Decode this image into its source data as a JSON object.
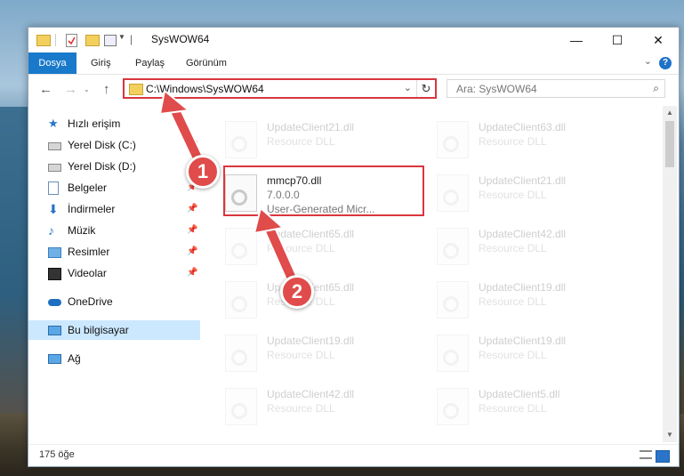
{
  "window": {
    "title": "SysWOW64",
    "controls": {
      "minimize": "—",
      "maximize": "☐",
      "close": "✕"
    }
  },
  "ribbon": {
    "tabs": [
      "Dosya",
      "Giriş",
      "Paylaş",
      "Görünüm"
    ],
    "help": "?"
  },
  "address": {
    "path": "C:\\Windows\\SysWOW64",
    "search_placeholder": "Ara: SysWOW64"
  },
  "nav": {
    "items": [
      {
        "label": "Hızlı erişim",
        "icon": "star-icon"
      },
      {
        "label": "Yerel Disk (C:)",
        "icon": "drive-icon",
        "pinned": true
      },
      {
        "label": "Yerel Disk (D:)",
        "icon": "drive-icon",
        "pinned": true
      },
      {
        "label": "Belgeler",
        "icon": "document-icon",
        "pinned": true
      },
      {
        "label": "İndirmeler",
        "icon": "download-icon",
        "pinned": true
      },
      {
        "label": "Müzik",
        "icon": "music-icon",
        "pinned": true
      },
      {
        "label": "Resimler",
        "icon": "pictures-icon",
        "pinned": true
      },
      {
        "label": "Videolar",
        "icon": "video-icon",
        "pinned": true
      },
      {
        "label": "OneDrive",
        "icon": "cloud-icon"
      },
      {
        "label": "Bu bilgisayar",
        "icon": "computer-icon",
        "selected": true
      },
      {
        "label": "Ağ",
        "icon": "network-icon"
      }
    ]
  },
  "files": {
    "left": [
      {
        "name": "UpdateClient21.dll",
        "type": "Resource DLL"
      },
      {
        "name": "mmcp70.dll",
        "type": "7.0.0.0",
        "extra": "User-Generated Micr...",
        "highlighted": true
      },
      {
        "name": "UpdateClient65.dll",
        "type": "Resource DLL"
      },
      {
        "name": "UpdateClient65.dll",
        "type": "Resource DLL"
      },
      {
        "name": "UpdateClient19.dll",
        "type": "Resource DLL"
      },
      {
        "name": "UpdateClient42.dll",
        "type": "Resource DLL"
      }
    ],
    "right": [
      {
        "name": "UpdateClient63.dll",
        "type": "Resource DLL"
      },
      {
        "name": "UpdateClient21.dll",
        "type": "Resource DLL"
      },
      {
        "name": "UpdateClient42.dll",
        "type": "Resource DLL"
      },
      {
        "name": "UpdateClient19.dll",
        "type": "Resource DLL"
      },
      {
        "name": "UpdateClient19.dll",
        "type": "Resource DLL"
      },
      {
        "name": "UpdateClient5.dll",
        "type": "Resource DLL"
      }
    ]
  },
  "status": {
    "count": "175 öğe"
  },
  "callouts": {
    "one": "1",
    "two": "2"
  },
  "colors": {
    "accent": "#1979ca",
    "highlight": "#d9363e",
    "callout": "#e04b4b",
    "nav_selected": "#cce8ff"
  }
}
